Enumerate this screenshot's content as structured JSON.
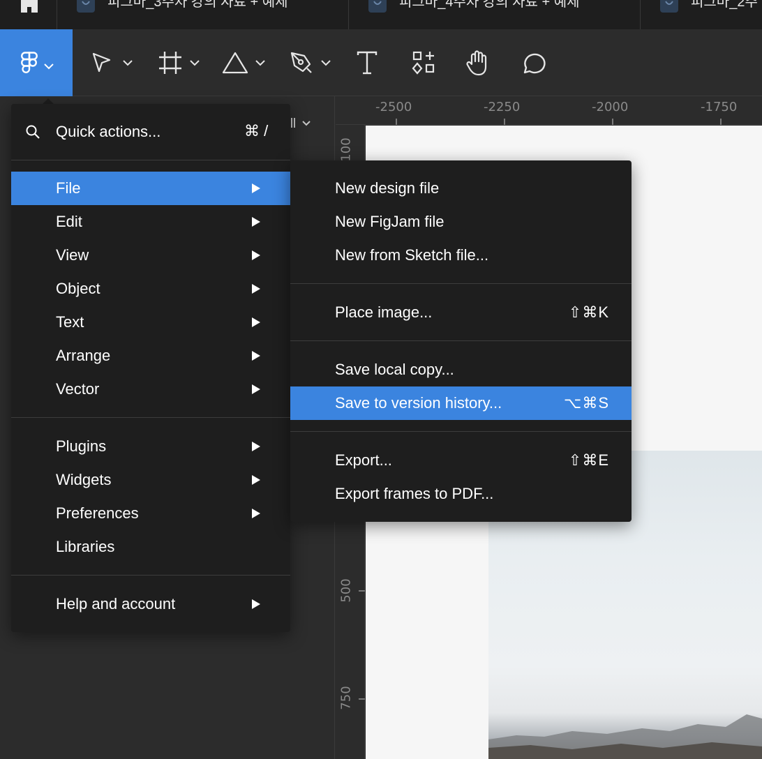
{
  "tabs": [
    {
      "title": "피그마_3주차 강의 자료 + 예제"
    },
    {
      "title": "피그마_4주차 강의 자료 + 예제"
    },
    {
      "title": "피그마_2주"
    }
  ],
  "toolbar": {
    "tools": [
      "figma-menu",
      "move",
      "frame",
      "shape",
      "pen",
      "text",
      "resources",
      "hand",
      "comment"
    ]
  },
  "rulers": {
    "top": [
      "-2500",
      "-2250",
      "-2000",
      "-1750"
    ],
    "left": [
      "100",
      "500",
      "750"
    ]
  },
  "menu": {
    "quick_actions": {
      "label": "Quick actions...",
      "shortcut": "⌘ /"
    },
    "items": [
      {
        "label": "File"
      },
      {
        "label": "Edit"
      },
      {
        "label": "View"
      },
      {
        "label": "Object"
      },
      {
        "label": "Text"
      },
      {
        "label": "Arrange"
      },
      {
        "label": "Vector"
      },
      {
        "label": "Plugins"
      },
      {
        "label": "Widgets"
      },
      {
        "label": "Preferences"
      },
      {
        "label": "Libraries"
      },
      {
        "label": "Help and account"
      }
    ]
  },
  "file_menu": {
    "items": [
      {
        "label": "New design file",
        "shortcut": ""
      },
      {
        "label": "New FigJam file",
        "shortcut": ""
      },
      {
        "label": "New from Sketch file...",
        "shortcut": ""
      },
      {
        "label": "Place image...",
        "shortcut": "⇧⌘K"
      },
      {
        "label": "Save local copy...",
        "shortcut": ""
      },
      {
        "label": "Save to version history...",
        "shortcut": "⌥⌘S"
      },
      {
        "label": "Export...",
        "shortcut": "⇧⌘E"
      },
      {
        "label": "Export frames to PDF...",
        "shortcut": ""
      }
    ]
  },
  "colors": {
    "accent": "#3b84df",
    "menu_bg": "#1e1e1e",
    "toolbar_bg": "#2c2c2c"
  }
}
